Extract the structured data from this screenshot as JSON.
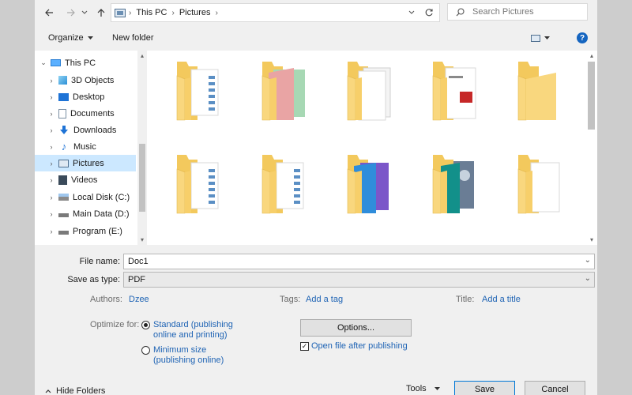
{
  "address_bar": {
    "back_icon": "arrow-left-icon",
    "forward_icon": "arrow-right-icon",
    "recent_icon": "chevron-down-icon",
    "up_icon": "arrow-up-icon",
    "breadcrumbs": [
      "This PC",
      "Pictures"
    ],
    "refresh_icon": "refresh-icon",
    "search_placeholder": "Search Pictures"
  },
  "toolbar": {
    "organize_label": "Organize",
    "new_folder_label": "New folder",
    "help_label": "?"
  },
  "nav_tree": {
    "items": [
      {
        "label": "This PC",
        "icon": "pc-icon",
        "expanded": true
      },
      {
        "label": "3D Objects",
        "icon": "cube-icon"
      },
      {
        "label": "Desktop",
        "icon": "desktop-icon"
      },
      {
        "label": "Documents",
        "icon": "documents-icon"
      },
      {
        "label": "Downloads",
        "icon": "download-icon"
      },
      {
        "label": "Music",
        "icon": "music-icon"
      },
      {
        "label": "Pictures",
        "icon": "pictures-icon",
        "selected": true
      },
      {
        "label": "Videos",
        "icon": "videos-icon"
      },
      {
        "label": "Local Disk (C:)",
        "icon": "drive-icon"
      },
      {
        "label": "Main Data (D:)",
        "icon": "drive-icon"
      },
      {
        "label": "Program (E:)",
        "icon": "drive-icon"
      }
    ]
  },
  "folders": [
    {
      "variant": "docs"
    },
    {
      "variant": "pink-green"
    },
    {
      "variant": "white-pages"
    },
    {
      "variant": "red-cover"
    },
    {
      "variant": "plain"
    },
    {
      "variant": "docs"
    },
    {
      "variant": "docs"
    },
    {
      "variant": "blue-purple"
    },
    {
      "variant": "teal-photo"
    },
    {
      "variant": "white-page"
    }
  ],
  "form": {
    "file_name_label": "File name:",
    "file_name_value": "Doc1",
    "save_type_label": "Save as type:",
    "save_type_value": "PDF",
    "authors_label": "Authors:",
    "authors_value": "Dzee",
    "tags_label": "Tags:",
    "tags_value": "Add a tag",
    "title_label": "Title:",
    "title_value": "Add a title",
    "optimize_label": "Optimize for:",
    "option_standard_line1": "Standard (publishing",
    "option_standard_line2": "online and printing)",
    "option_minimum_line1": "Minimum size",
    "option_minimum_line2": "(publishing online)",
    "options_button": "Options...",
    "open_after_label": "Open file after publishing"
  },
  "footer": {
    "hide_folders_label": "Hide Folders",
    "tools_label": "Tools",
    "save_button": "Save",
    "cancel_button": "Cancel"
  },
  "colors": {
    "accent": "#0078d7",
    "link": "#1e63b4",
    "selection": "#cce8ff",
    "folder": "#f9d77e"
  }
}
